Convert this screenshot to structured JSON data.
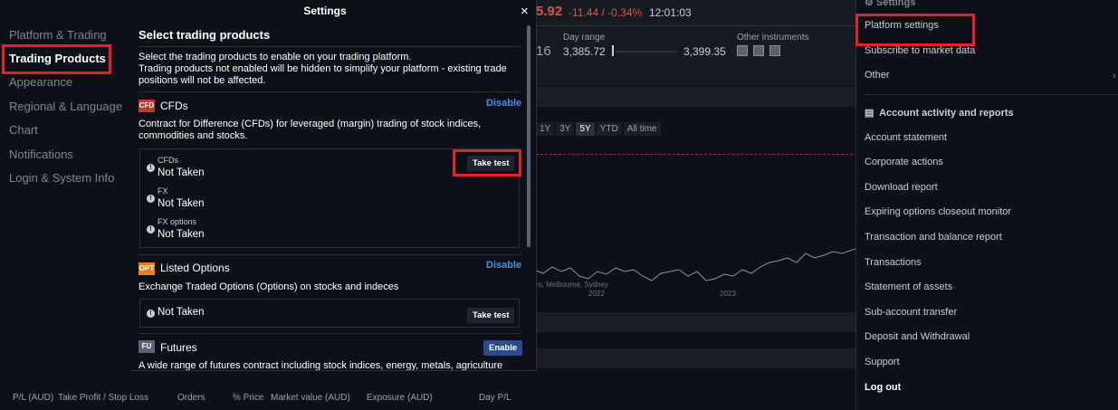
{
  "header": {
    "price": "5.92",
    "change": "-11.44 / -0.34%",
    "time": "12:01:03",
    "big_digits": "16",
    "day_range_label": "Day range",
    "day_range_low": "3,385.72",
    "day_range_high": "3,399.35",
    "other_instruments_label": "Other instruments"
  },
  "chart": {
    "periods": [
      "1Y",
      "3Y",
      "5Y",
      "YTD",
      "All time"
    ],
    "active_period": "5Y",
    "note": "rs, Melbourne, Sydney",
    "year_labels": [
      "2022",
      "2023"
    ]
  },
  "grid_headers": [
    "P/L (AUD)",
    "Take Profit / Stop Loss",
    "Orders",
    "% Price",
    "Market value (AUD)",
    "Exposure (AUD)",
    "Day P/L"
  ],
  "left_nav": {
    "items": [
      "Platform & Trading",
      "Trading Products",
      "Appearance",
      "Regional & Language",
      "Chart",
      "Notifications",
      "Login & System Info"
    ]
  },
  "dialog": {
    "title": "Settings",
    "close_symbol": "×",
    "heading": "Select trading products",
    "description_1": "Select the trading products to enable on your trading platform.",
    "description_2": "Trading products not enabled will be hidden to simplify your platform - existing trade positions will not be affected.",
    "products": [
      {
        "icon_text": "CFD",
        "icon_color": "#c0392b",
        "name": "CFDs",
        "action": "Disable",
        "description": "Contract for Difference (CFDs) for leveraged (margin) trading of stock indices, commodities and stocks.",
        "tests": [
          {
            "label": "CFDs",
            "status": "Not Taken"
          },
          {
            "label": "FX",
            "status": "Not Taken"
          },
          {
            "label": "FX options",
            "status": "Not Taken"
          }
        ],
        "test_button": "Take test"
      },
      {
        "icon_text": "OPT",
        "icon_color": "#e67e22",
        "name": "Listed Options",
        "action": "Disable",
        "description": "Exchange Traded Options (Options) on stocks and indeces",
        "status": "Not Taken",
        "test_button": "Take test"
      },
      {
        "icon_text": "FU",
        "icon_color": "#5a6475",
        "name": "Futures",
        "action": "Enable",
        "description": "A wide range of futures contract including stock indices, energy, metals, agriculture"
      }
    ]
  },
  "right_panel": {
    "top_partial": "Settings",
    "items_1": [
      "Platform settings",
      "Subscribe to market data",
      "Other"
    ],
    "section_header": "Account activity and reports",
    "items_2": [
      "Account statement",
      "Corporate actions",
      "Download report",
      "Expiring options closeout monitor",
      "Transaction and balance report",
      "Transactions",
      "Statement of assets",
      "Sub-account transfer",
      "Deposit and Withdrawal",
      "Support"
    ],
    "logout": "Log out"
  },
  "colors": {
    "highlight": "#e5202a",
    "link": "#4a8fe7",
    "negative": "#d9534f",
    "background": "#0d1117"
  }
}
